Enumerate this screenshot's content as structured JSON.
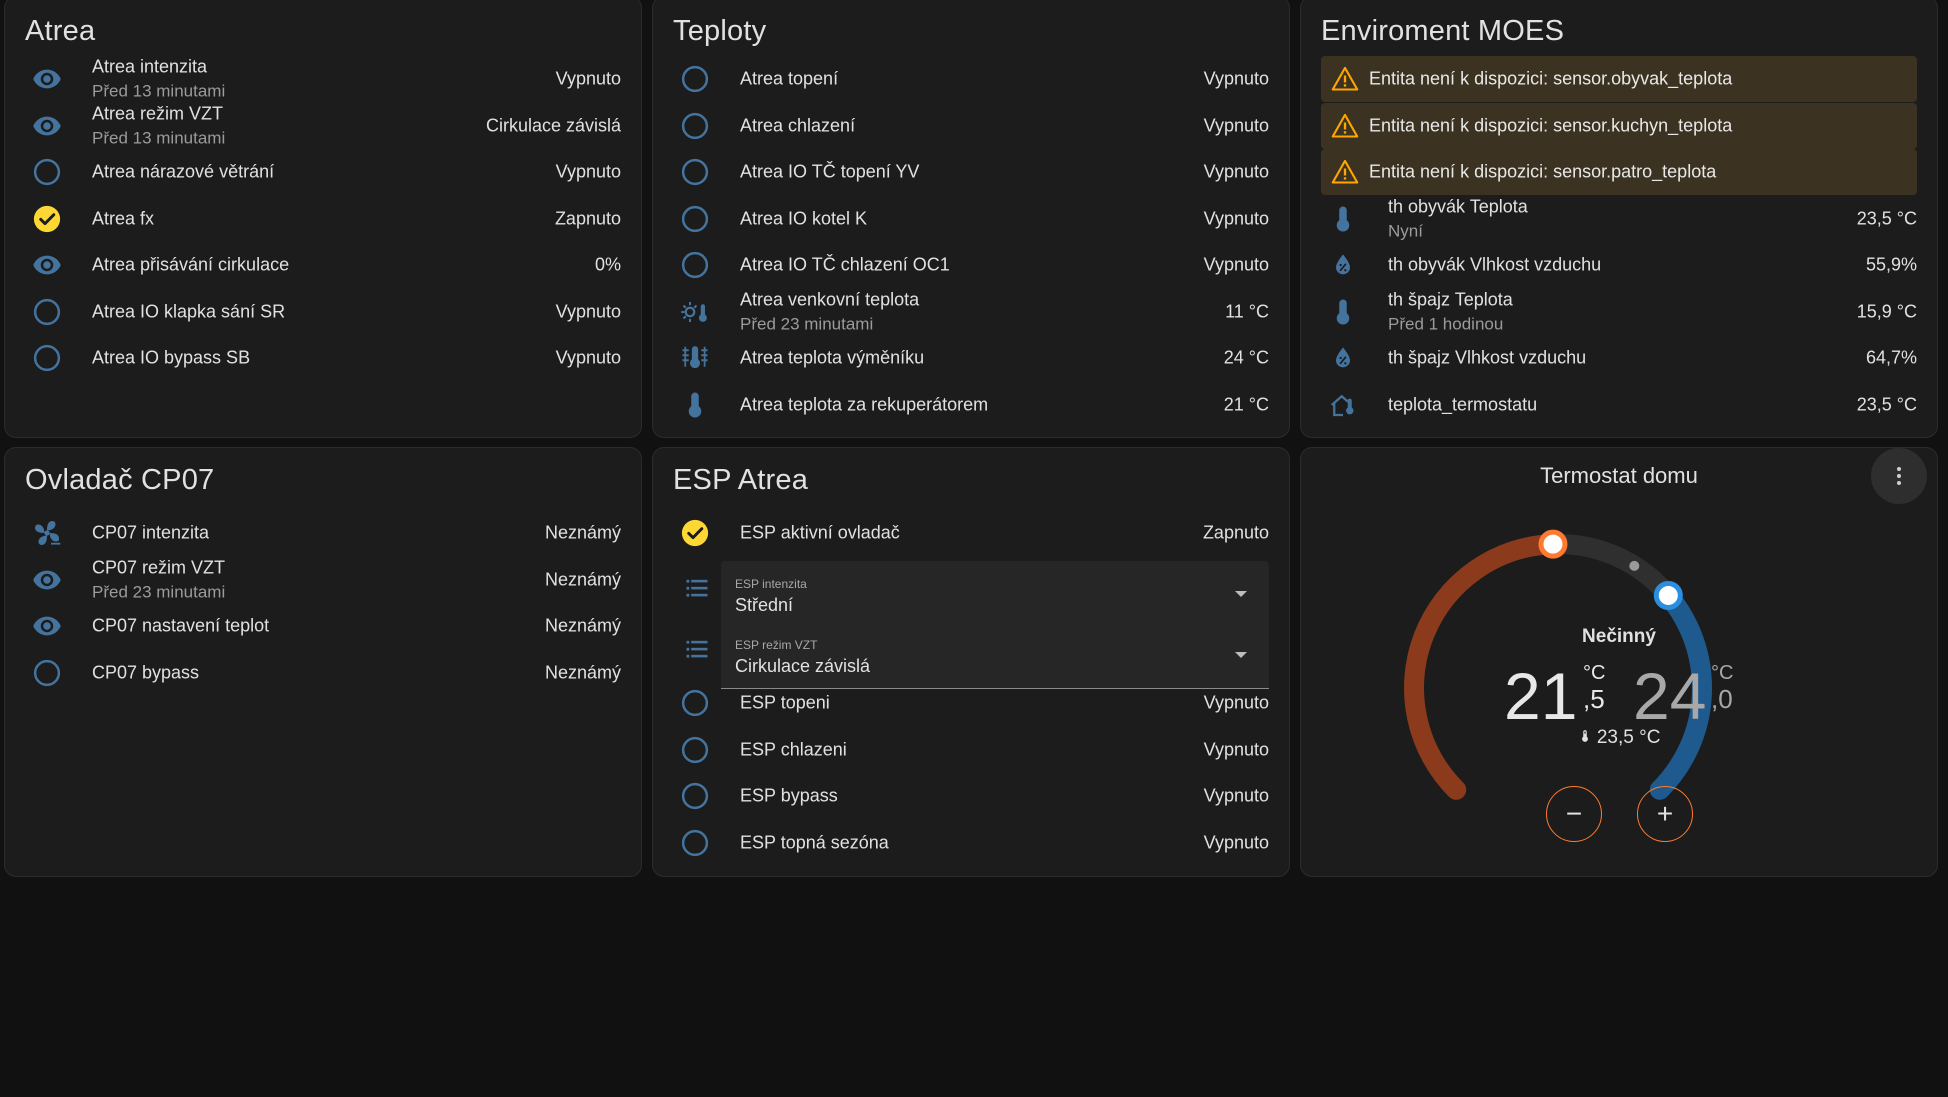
{
  "colors": {
    "icon_blue": "#44739e",
    "on_yellow": "#fdd835",
    "warning": "#ffa600",
    "heat": "#8b3a1c",
    "heat_handle": "#ff7a30",
    "cool": "#1e5a8e",
    "cool_handle": "#2a8fe0"
  },
  "atrea": {
    "title": "Atrea",
    "rows": [
      {
        "icon": "eye-icon",
        "name": "Atrea intenzita",
        "sub": "Před 13 minutami",
        "value": "Vypnuto"
      },
      {
        "icon": "eye-icon",
        "name": "Atrea režim VZT",
        "sub": "Před 13 minutami",
        "value": "Cirkulace závislá"
      },
      {
        "icon": "circle-outline-icon",
        "name": "Atrea nárazové větrání",
        "value": "Vypnuto"
      },
      {
        "icon": "check-circle-icon",
        "name": "Atrea fx",
        "value": "Zapnuto"
      },
      {
        "icon": "eye-icon",
        "name": "Atrea přisávání cirkulace",
        "value": "0%"
      },
      {
        "icon": "circle-outline-icon",
        "name": "Atrea IO klapka sání SR",
        "value": "Vypnuto"
      },
      {
        "icon": "circle-outline-icon",
        "name": "Atrea IO bypass SB",
        "value": "Vypnuto"
      }
    ]
  },
  "teploty": {
    "title": "Teploty",
    "rows": [
      {
        "icon": "circle-outline-icon",
        "name": "Atrea topení",
        "value": "Vypnuto"
      },
      {
        "icon": "circle-outline-icon",
        "name": "Atrea chlazení",
        "value": "Vypnuto"
      },
      {
        "icon": "circle-outline-icon",
        "name": "Atrea IO TČ topení YV",
        "value": "Vypnuto"
      },
      {
        "icon": "circle-outline-icon",
        "name": "Atrea IO kotel K",
        "value": "Vypnuto"
      },
      {
        "icon": "circle-outline-icon",
        "name": "Atrea IO TČ chlazení OC1",
        "value": "Vypnuto"
      },
      {
        "icon": "sun-thermometer-icon",
        "name": "Atrea venkovní teplota",
        "sub": "Před 23 minutami",
        "value": "11 °C"
      },
      {
        "icon": "heat-exchanger-icon",
        "name": "Atrea teplota výměníku",
        "value": "24 °C"
      },
      {
        "icon": "thermometer-icon",
        "name": "Atrea teplota za rekuperátorem",
        "value": "21 °C"
      }
    ]
  },
  "moes": {
    "title": "Enviroment MOES",
    "warnings": [
      "Entita není k dispozici: sensor.obyvak_teplota",
      "Entita není k dispozici: sensor.kuchyn_teplota",
      "Entita není k dispozici: sensor.patro_teplota"
    ],
    "rows": [
      {
        "icon": "thermometer-icon",
        "name": "th obyvák Teplota",
        "sub": "Nyní",
        "value": "23,5 °C"
      },
      {
        "icon": "water-percent-icon",
        "name": "th obyvák Vlhkost vzduchu",
        "value": "55,9%"
      },
      {
        "icon": "thermometer-icon",
        "name": "th špajz Teplota",
        "sub": "Před 1 hodinou",
        "value": "15,9 °C"
      },
      {
        "icon": "water-percent-icon",
        "name": "th špajz Vlhkost vzduchu",
        "value": "64,7%"
      },
      {
        "icon": "home-thermometer-icon",
        "name": "teplota_termostatu",
        "value": "23,5 °C"
      }
    ]
  },
  "cp07": {
    "title": "Ovladač CP07",
    "rows": [
      {
        "icon": "fan-icon",
        "name": "CP07 intenzita",
        "value": "Neznámý"
      },
      {
        "icon": "eye-icon",
        "name": "CP07 režim VZT",
        "sub": "Před 23 minutami",
        "value": "Neznámý"
      },
      {
        "icon": "eye-icon",
        "name": "CP07 nastavení teplot",
        "value": "Neznámý"
      },
      {
        "icon": "circle-outline-icon",
        "name": "CP07 bypass",
        "value": "Neznámý"
      }
    ]
  },
  "esp": {
    "title": "ESP Atrea",
    "active": {
      "icon": "check-circle-icon",
      "name": "ESP aktivní ovladač",
      "value": "Zapnuto"
    },
    "selects": [
      {
        "label": "ESP intenzita",
        "value": "Střední"
      },
      {
        "label": "ESP režim VZT",
        "value": "Cirkulace závislá"
      }
    ],
    "rows": [
      {
        "icon": "circle-outline-icon",
        "name": "ESP topeni",
        "value": "Vypnuto"
      },
      {
        "icon": "circle-outline-icon",
        "name": "ESP chlazeni",
        "value": "Vypnuto"
      },
      {
        "icon": "circle-outline-icon",
        "name": "ESP bypass",
        "value": "Vypnuto"
      },
      {
        "icon": "circle-outline-icon",
        "name": "ESP topná sezóna",
        "value": "Vypnuto"
      }
    ]
  },
  "thermostat": {
    "title": "Termostat domu",
    "state": "Nečinný",
    "low_int": "21",
    "low_dec": ",5",
    "high_int": "24",
    "high_dec": ",0",
    "unit": "°C",
    "current": "23,5 °C",
    "minus": "−",
    "plus": "+"
  }
}
